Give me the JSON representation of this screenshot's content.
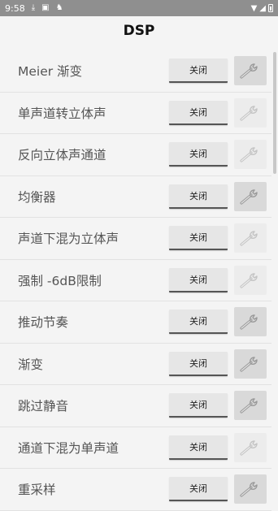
{
  "status_bar": {
    "time": "9:58",
    "icons": [
      "download-icon",
      "notification-icon",
      "app-icon"
    ],
    "right_icons": [
      "wifi-icon",
      "signal-icon",
      "battery-icon"
    ]
  },
  "title": "DSP",
  "items": [
    {
      "label": "Meier 渐变",
      "toggle": "关闭",
      "settings_enabled": true
    },
    {
      "label": "单声道转立体声",
      "toggle": "关闭",
      "settings_enabled": false
    },
    {
      "label": "反向立体声通道",
      "toggle": "关闭",
      "settings_enabled": false
    },
    {
      "label": "均衡器",
      "toggle": "关闭",
      "settings_enabled": true
    },
    {
      "label": "声道下混为立体声",
      "toggle": "关闭",
      "settings_enabled": false
    },
    {
      "label": "强制 -6dB限制",
      "toggle": "关闭",
      "settings_enabled": false
    },
    {
      "label": "推动节奏",
      "toggle": "关闭",
      "settings_enabled": true
    },
    {
      "label": "渐变",
      "toggle": "关闭",
      "settings_enabled": true
    },
    {
      "label": "跳过静音",
      "toggle": "关闭",
      "settings_enabled": true
    },
    {
      "label": "通道下混为单声道",
      "toggle": "关闭",
      "settings_enabled": false
    },
    {
      "label": "重采样",
      "toggle": "关闭",
      "settings_enabled": true
    }
  ]
}
